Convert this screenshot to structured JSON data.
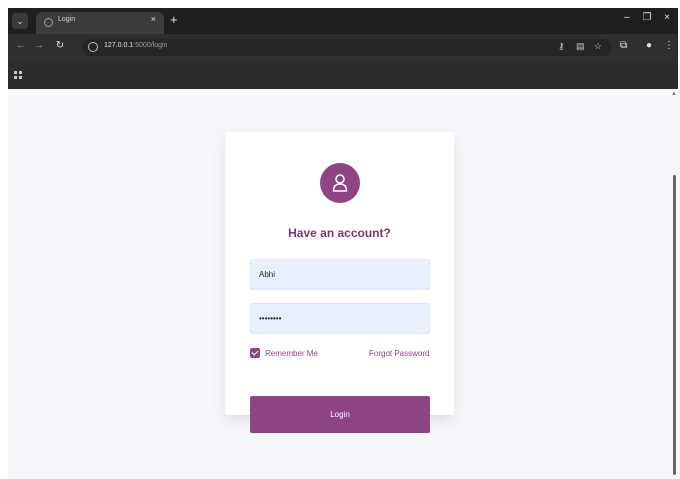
{
  "browser": {
    "tab": {
      "title": "Login",
      "close": "×"
    },
    "new_tab": "+",
    "window_controls": {
      "minimize": "–",
      "restore": "❐",
      "close": "×"
    },
    "nav": {
      "back": "←",
      "forward": "→",
      "reload": "↻"
    },
    "url": {
      "host": "127.0.0.1",
      "rest": ":5000/login"
    },
    "toolbar_icons": [
      "key-icon",
      "translate-icon",
      "star-icon",
      "extensions-icon",
      "profile-icon",
      "menu-icon"
    ]
  },
  "login": {
    "heading": "Have an account?",
    "username_value": "Abhi",
    "password_value": "••••••••",
    "remember_label": "Remember Me",
    "remember_checked": true,
    "forgot_label": "Forgot Password",
    "submit_label": "Login"
  },
  "colors": {
    "accent": "#8d4585",
    "heading": "#7a3670",
    "field_bg": "#e8effd",
    "page_bg": "#f6f7fb"
  }
}
